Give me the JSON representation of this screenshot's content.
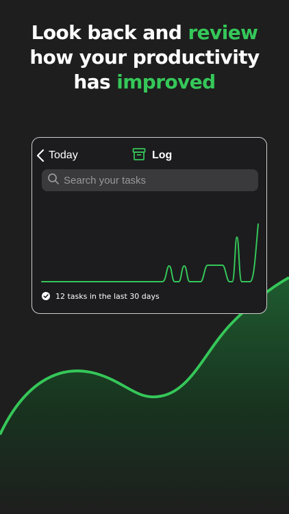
{
  "headline": {
    "line1_a": "Look back and ",
    "line1_highlight": "review",
    "line2": "how your productivity",
    "line3_a": "has ",
    "line3_highlight": "improved"
  },
  "card": {
    "back_label": "Today",
    "title": "Log",
    "search_placeholder": "Search your tasks",
    "search_value": "",
    "summary": "12 tasks in the last 30 days"
  },
  "icons": {
    "back": "chevron-left-icon",
    "title": "archive-box-icon",
    "search": "magnifier-icon",
    "summary": "checkmark-circle-icon"
  },
  "colors": {
    "accent": "#35c759",
    "background": "#1e1e1e",
    "card_background": "#1c1c1e",
    "card_border": "#cfcfcf",
    "search_background": "#3a3a3c",
    "placeholder": "#98989d"
  }
}
